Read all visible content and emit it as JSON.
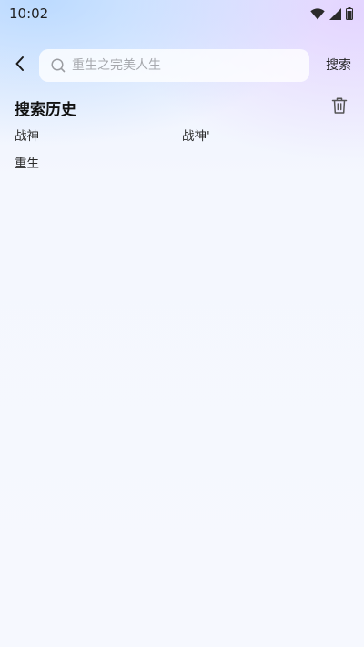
{
  "status_bar": {
    "time": "10:02",
    "icons": [
      "wifi-icon",
      "cell-signal-icon",
      "battery-icon"
    ]
  },
  "search": {
    "placeholder": "重生之完美人生",
    "value": "",
    "button_label": "搜索"
  },
  "history": {
    "title": "搜索历史",
    "items": [
      "战神",
      "战神'",
      "重生"
    ]
  },
  "colors": {
    "text_primary": "#111111",
    "placeholder": "#a6a8ad"
  }
}
